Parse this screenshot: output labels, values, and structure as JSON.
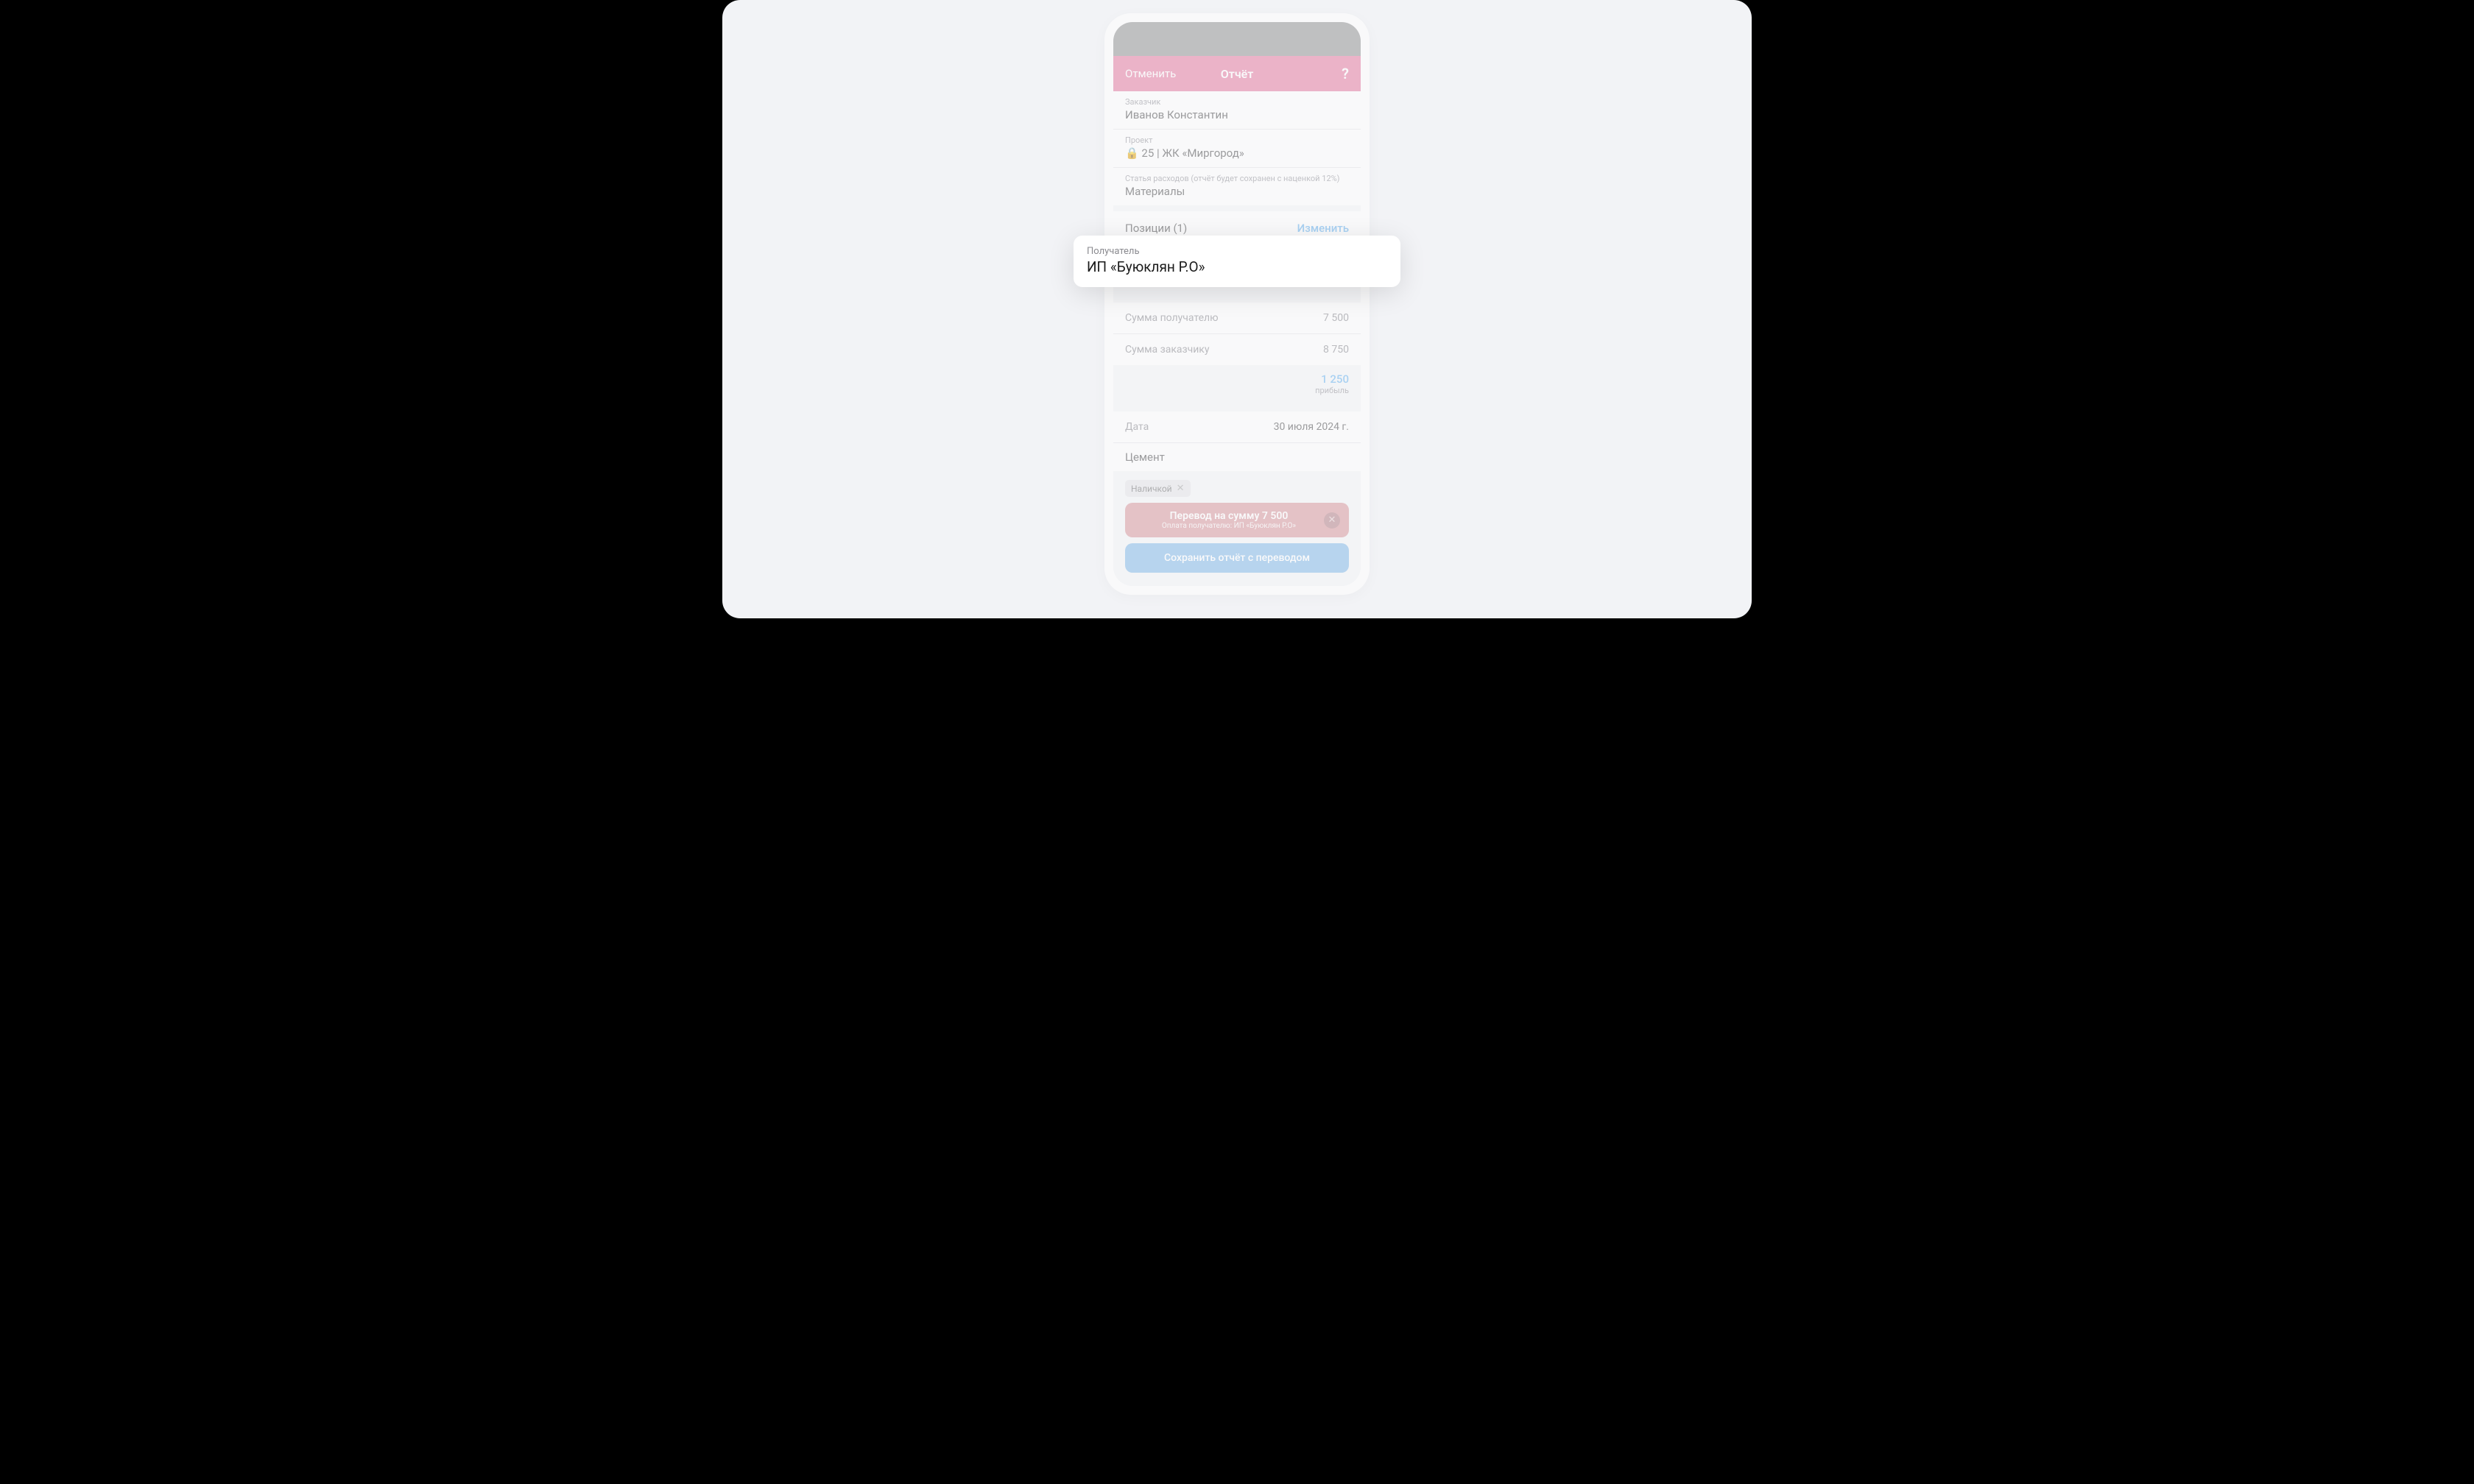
{
  "nav": {
    "cancel": "Отменить",
    "title": "Отчёт",
    "help": "?"
  },
  "client": {
    "label": "Заказчик",
    "value": "Иванов Константин"
  },
  "project": {
    "label": "Проект",
    "value": "🔒 25 | ЖК «Миргород»"
  },
  "expense": {
    "label": "Статья расходов (отчёт будет сохранен с наценкой 12%)",
    "value": "Материалы"
  },
  "positions": {
    "label": "Позиции (1)",
    "edit": "Изменить"
  },
  "recipient": {
    "label": "Получатель",
    "value": "ИП «Буюклян Р.О»"
  },
  "amounts": {
    "to_recipient_label": "Сумма получателю",
    "to_recipient_value": "7 500",
    "to_client_label": "Сумма заказчику",
    "to_client_value": "8 750"
  },
  "profit": {
    "amount": "1 250",
    "label": "прибыль"
  },
  "date": {
    "label": "Дата",
    "value": "30 июля 2024 г."
  },
  "note": "Цемент",
  "tag": {
    "label": "Наличкой"
  },
  "transfer": {
    "title": "Перевод на сумму 7 500",
    "sub": "Оплата получателю: ИП «Буюклян Р.О»"
  },
  "save_button": "Сохранить отчёт с переводом"
}
